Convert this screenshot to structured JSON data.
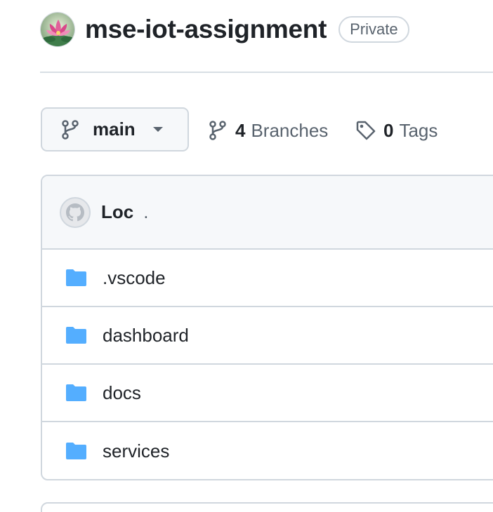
{
  "repo": {
    "name": "mse-iot-assignment",
    "visibility": "Private",
    "owner_avatar_icon": "lotus-avatar-icon"
  },
  "branch_bar": {
    "current_branch": "main",
    "branch_count": "4",
    "branch_label": "Branches",
    "tag_count": "0",
    "tag_label": "Tags"
  },
  "latest_commit": {
    "author": "Loc",
    "message": ".",
    "avatar_icon": "github-octocat-icon"
  },
  "files": [
    {
      "name": ".vscode",
      "type": "folder"
    },
    {
      "name": "dashboard",
      "type": "folder"
    },
    {
      "name": "docs",
      "type": "folder"
    },
    {
      "name": "services",
      "type": "folder"
    }
  ],
  "colors": {
    "folder": "#54aeff",
    "border": "#d0d7de",
    "muted_text": "#59636e",
    "text": "#1f2328"
  }
}
